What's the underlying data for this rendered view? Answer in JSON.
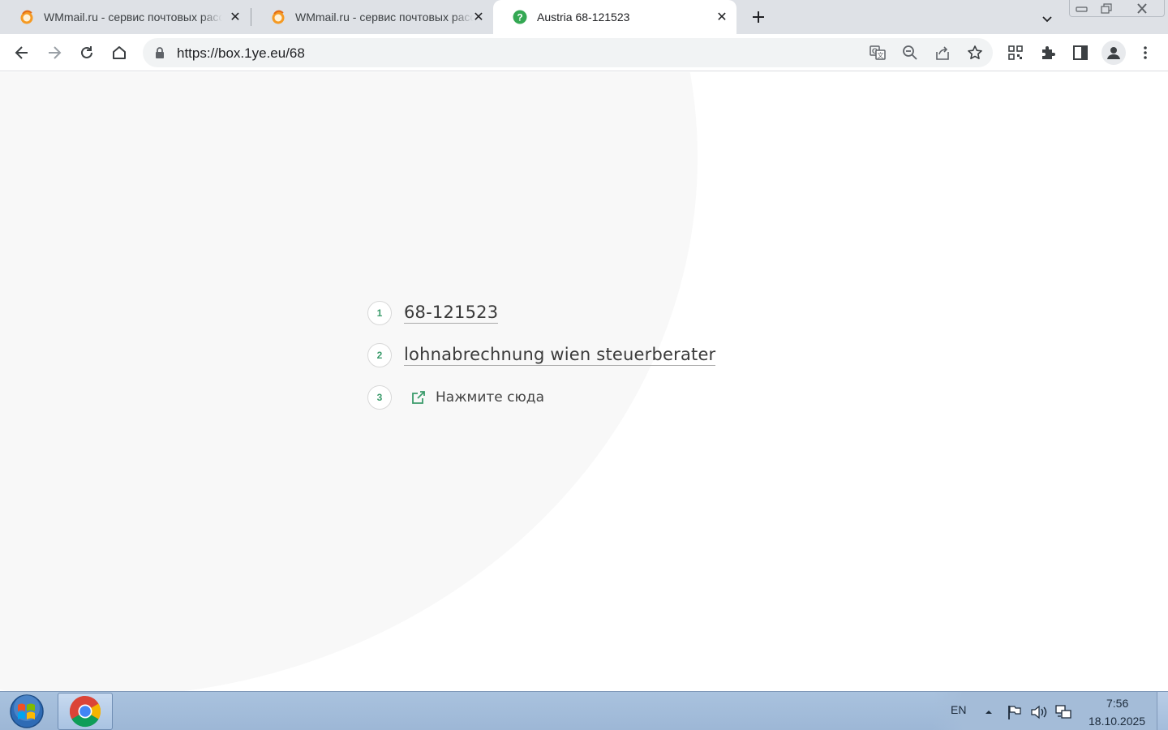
{
  "browser": {
    "tabs": [
      {
        "title": "WMmail.ru - сервис почтовых рассылок",
        "favicon": "wmmail-icon",
        "active": false
      },
      {
        "title": "WMmail.ru - сервис почтовых рассылок",
        "favicon": "wmmail-icon",
        "active": false
      },
      {
        "title": "Austria 68-121523",
        "favicon": "help-icon",
        "active": true
      }
    ],
    "url": "https://box.1ye.eu/68",
    "accent": "#1a73e8"
  },
  "page": {
    "steps": [
      {
        "number": "1",
        "text": "68-121523"
      },
      {
        "number": "2",
        "text": "lohnabrechnung wien steuerberater"
      },
      {
        "number": "3",
        "text": "Нажмите сюда",
        "icon": "external-link-icon"
      }
    ],
    "accent": "#3a9b6b"
  },
  "taskbar": {
    "language": "EN",
    "time": "7:56",
    "date": "18.10.2025"
  }
}
